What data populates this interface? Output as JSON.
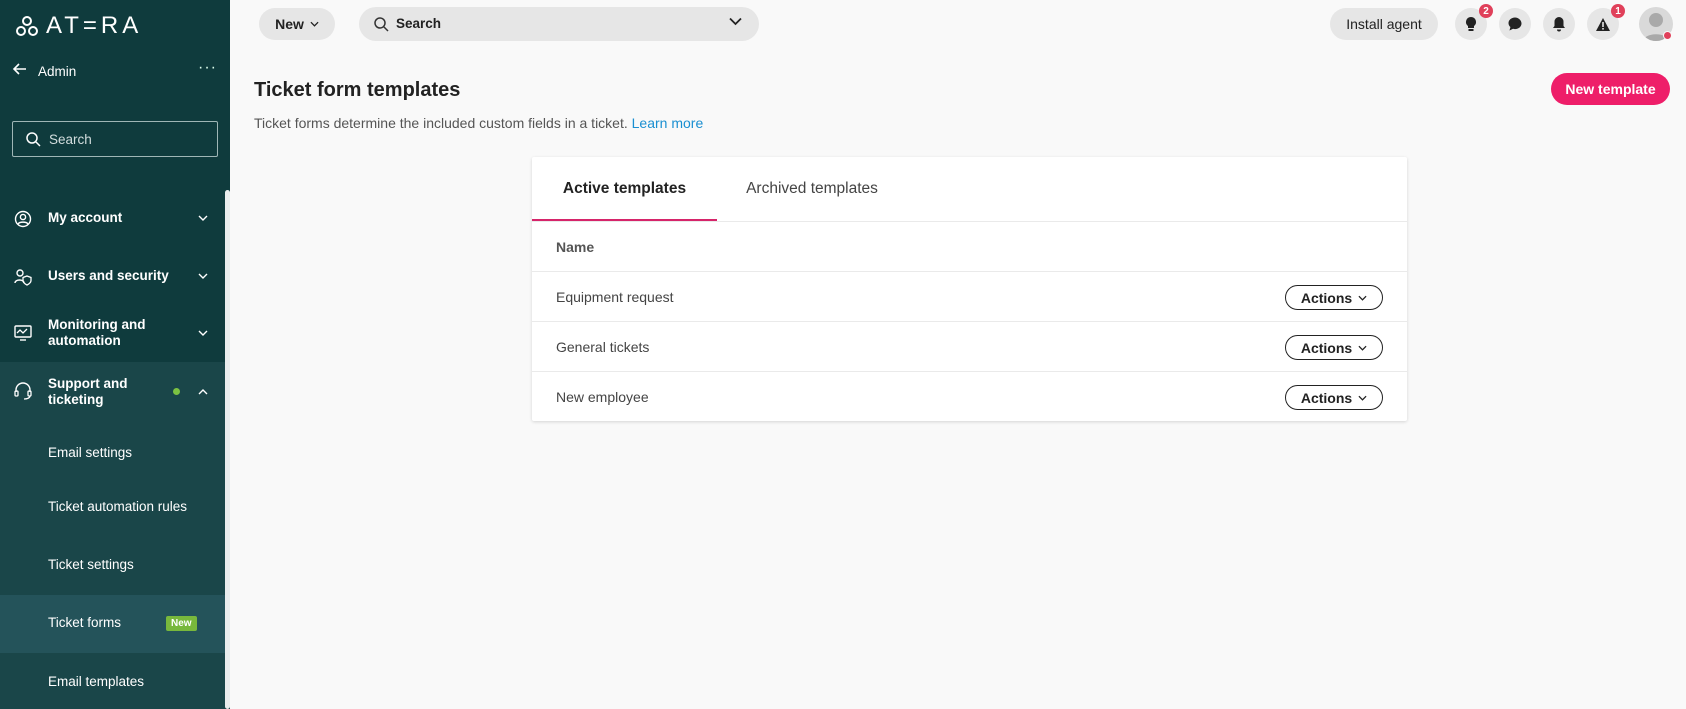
{
  "app": {
    "logo_text": "AT=RA"
  },
  "sidebar": {
    "back_label": "Admin",
    "more_label": "···",
    "search_placeholder": "Search",
    "groups": [
      {
        "label": "My account",
        "icon": "user-circle-icon"
      },
      {
        "label": "Users and security",
        "icon": "user-shield-icon"
      },
      {
        "label_line1": "Monitoring and",
        "label_line2": "automation",
        "icon": "monitor-icon"
      },
      {
        "label_line1": "Support and",
        "label_line2": "ticketing",
        "icon": "headset-icon",
        "status_color": "#7cc242"
      }
    ],
    "sub_items": [
      {
        "label": "Email settings"
      },
      {
        "label": "Ticket automation rules"
      },
      {
        "label": "Ticket settings"
      },
      {
        "label": "Ticket forms",
        "badge": "New"
      },
      {
        "label": "Email templates"
      }
    ]
  },
  "topbar": {
    "new_label": "New",
    "search_label": "Search",
    "install_label": "Install agent",
    "icons": [
      {
        "name": "lightbulb-icon",
        "count": "2"
      },
      {
        "name": "chat-icon"
      },
      {
        "name": "bell-icon"
      },
      {
        "name": "alert-icon",
        "count": "1"
      }
    ]
  },
  "page": {
    "title": "Ticket form templates",
    "description": "Ticket forms determine the included custom fields in a ticket.",
    "learn_more": "Learn more",
    "new_template_label": "New template"
  },
  "card": {
    "tabs": [
      {
        "label": "Active templates",
        "active": true
      },
      {
        "label": "Archived templates",
        "active": false
      }
    ],
    "column_name": "Name",
    "actions_label": "Actions",
    "rows": [
      {
        "name": "Equipment request"
      },
      {
        "name": "General tickets"
      },
      {
        "name": "New employee"
      }
    ]
  },
  "colors": {
    "sidebar_bg": "#0f3b3d",
    "accent": "#ee1e69",
    "tab_underline": "#d6246a",
    "link": "#1a8fd1",
    "badge_new": "#78b83c",
    "notification": "#e0405a"
  }
}
